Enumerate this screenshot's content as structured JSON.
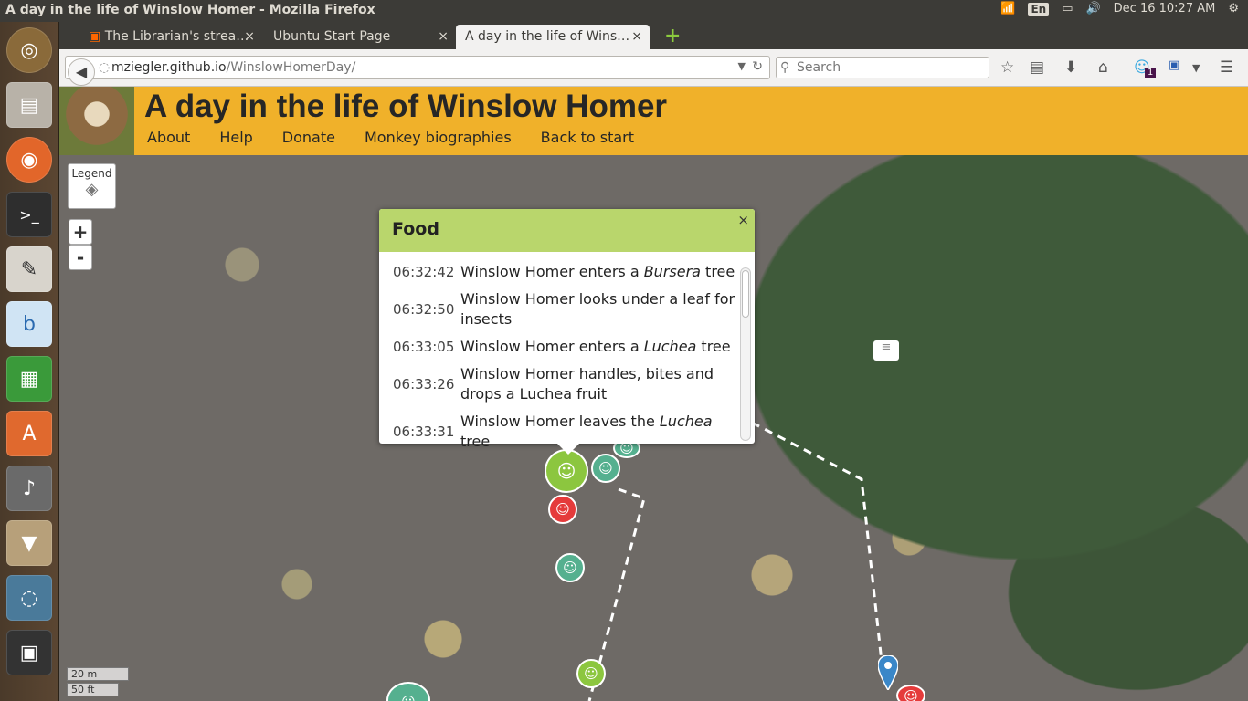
{
  "window": {
    "title": "A day in the life of Winslow Homer - Mozilla Firefox"
  },
  "system_tray": {
    "keyboard_lang": "En",
    "datetime": "Dec 16 10:27 AM"
  },
  "tabs": [
    {
      "label": "The Librarian's strea…",
      "close": "×"
    },
    {
      "label": "Ubuntu Start Page",
      "close": "×"
    },
    {
      "label": "A day in the life of Wins…",
      "close": "×"
    }
  ],
  "new_tab": "+",
  "navbar": {
    "url_domain": "mziegler.github.io",
    "url_path": "/WinslowHomerDay/",
    "search_placeholder": "Search",
    "notification_count": "1"
  },
  "site": {
    "title": "A day in the life of Winslow Homer",
    "menu": [
      "About",
      "Help",
      "Donate",
      "Monkey biographies",
      "Back to start"
    ]
  },
  "map": {
    "legend_label": "Legend",
    "zoom_in": "+",
    "zoom_out": "-",
    "scale_metric": "20 m",
    "scale_imperial": "50 ft"
  },
  "popup": {
    "title": "Food",
    "close": "×",
    "events": [
      {
        "time": "06:32:42",
        "before": "Winslow Homer enters a ",
        "italic": "Bursera",
        "after": " tree"
      },
      {
        "time": "06:32:50",
        "before": "Winslow Homer looks under a leaf for insects",
        "italic": "",
        "after": ""
      },
      {
        "time": "06:33:05",
        "before": "Winslow Homer enters a ",
        "italic": "Luchea",
        "after": " tree"
      },
      {
        "time": "06:33:26",
        "before": "Winslow Homer handles, bites and drops a Luchea fruit",
        "italic": "",
        "after": ""
      },
      {
        "time": "06:33:31",
        "before": "Winslow Homer leaves the ",
        "italic": "Luchea",
        "after": " tree"
      }
    ]
  },
  "colors": {
    "header": "#f0b12a",
    "popup_header": "#b9d66c",
    "food_marker": "#8cc63f",
    "group_marker": "#55b08f",
    "alert_marker": "#e53b3b",
    "pin": "#3a87c8"
  }
}
